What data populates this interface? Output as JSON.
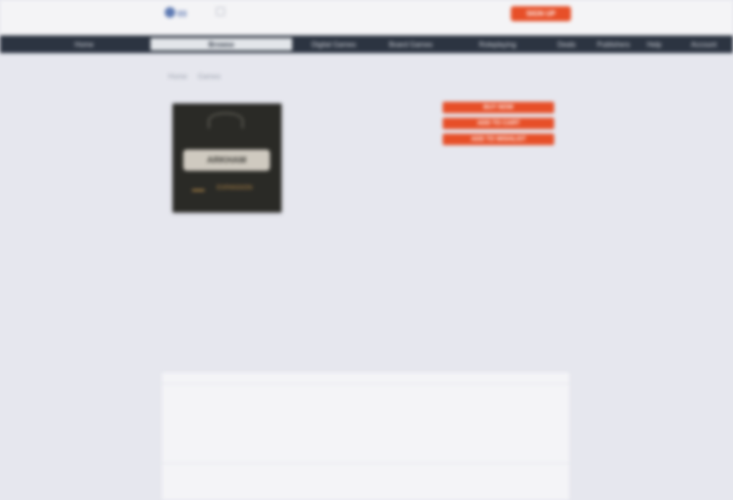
{
  "header": {
    "logo_text": "gg",
    "cta_label": "Sign Up"
  },
  "nav": {
    "items": [
      "Home",
      "Browse",
      "Digital Games",
      "Board Games",
      "Roleplaying",
      "Deals",
      "Publishers",
      "Help",
      "Account"
    ]
  },
  "breadcrumb": {
    "items": [
      "Home",
      "Games"
    ]
  },
  "product": {
    "cover_band_text": "ARKHAM",
    "cover_sub_text": "EXPANSION",
    "title": "",
    "meta_lines": [
      "",
      "",
      "",
      ""
    ],
    "description": ""
  },
  "purchase": {
    "buttons": [
      "Buy Now",
      "Add to Cart",
      "Add to Wishlist"
    ],
    "notes": [
      "",
      ""
    ]
  },
  "recommend": {
    "heading": ""
  },
  "columns": [
    {
      "head": "",
      "items": [
        "",
        "",
        "",
        ""
      ]
    },
    {
      "head": "",
      "items": [
        "",
        "",
        "",
        ""
      ]
    },
    {
      "head": "",
      "items": [
        "",
        "",
        "",
        ""
      ]
    }
  ],
  "section_link": "",
  "panel": {
    "group1": {
      "head": "",
      "items": [
        "",
        "",
        "",
        ""
      ]
    },
    "group2": {
      "head": "",
      "items": [
        "",
        ""
      ]
    }
  },
  "colors": {
    "accent": "#e74f28",
    "nav_bg": "#2c3441",
    "page_bg": "#e6e7ee"
  },
  "icons": {
    "top_icon": "menu-icon"
  }
}
